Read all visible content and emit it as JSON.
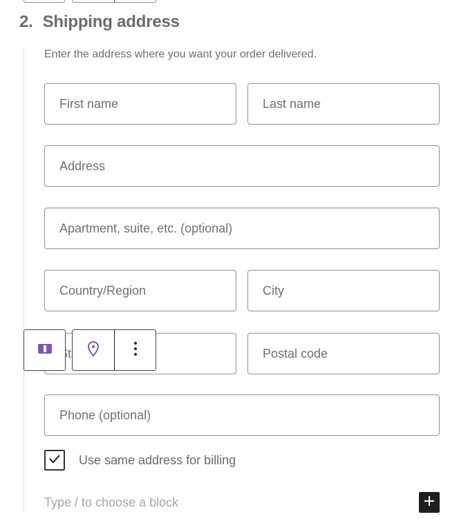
{
  "section": {
    "number": "2.",
    "title": "Shipping address",
    "description": "Enter the address where you want your order delivered."
  },
  "fields": {
    "first_name": "First name",
    "last_name": "Last name",
    "address": "Address",
    "apartment": "Apartment, suite, etc. (optional)",
    "country": "Country/Region",
    "city": "City",
    "state": "State",
    "postal_code": "Postal code",
    "phone": "Phone (optional)"
  },
  "toolbar": {
    "block_type_icon": "columns-icon",
    "location_icon": "map-pin-icon",
    "options_icon": "more-vertical-icon"
  },
  "billing": {
    "checked": true,
    "label": "Use same address for billing"
  },
  "appender": {
    "placeholder": "Type / to choose a block",
    "add_icon": "plus-icon"
  },
  "colors": {
    "accent": "#7f54b3",
    "toolbar_border": "#1e1e1e",
    "add_button_bg": "#1e1e1e"
  }
}
